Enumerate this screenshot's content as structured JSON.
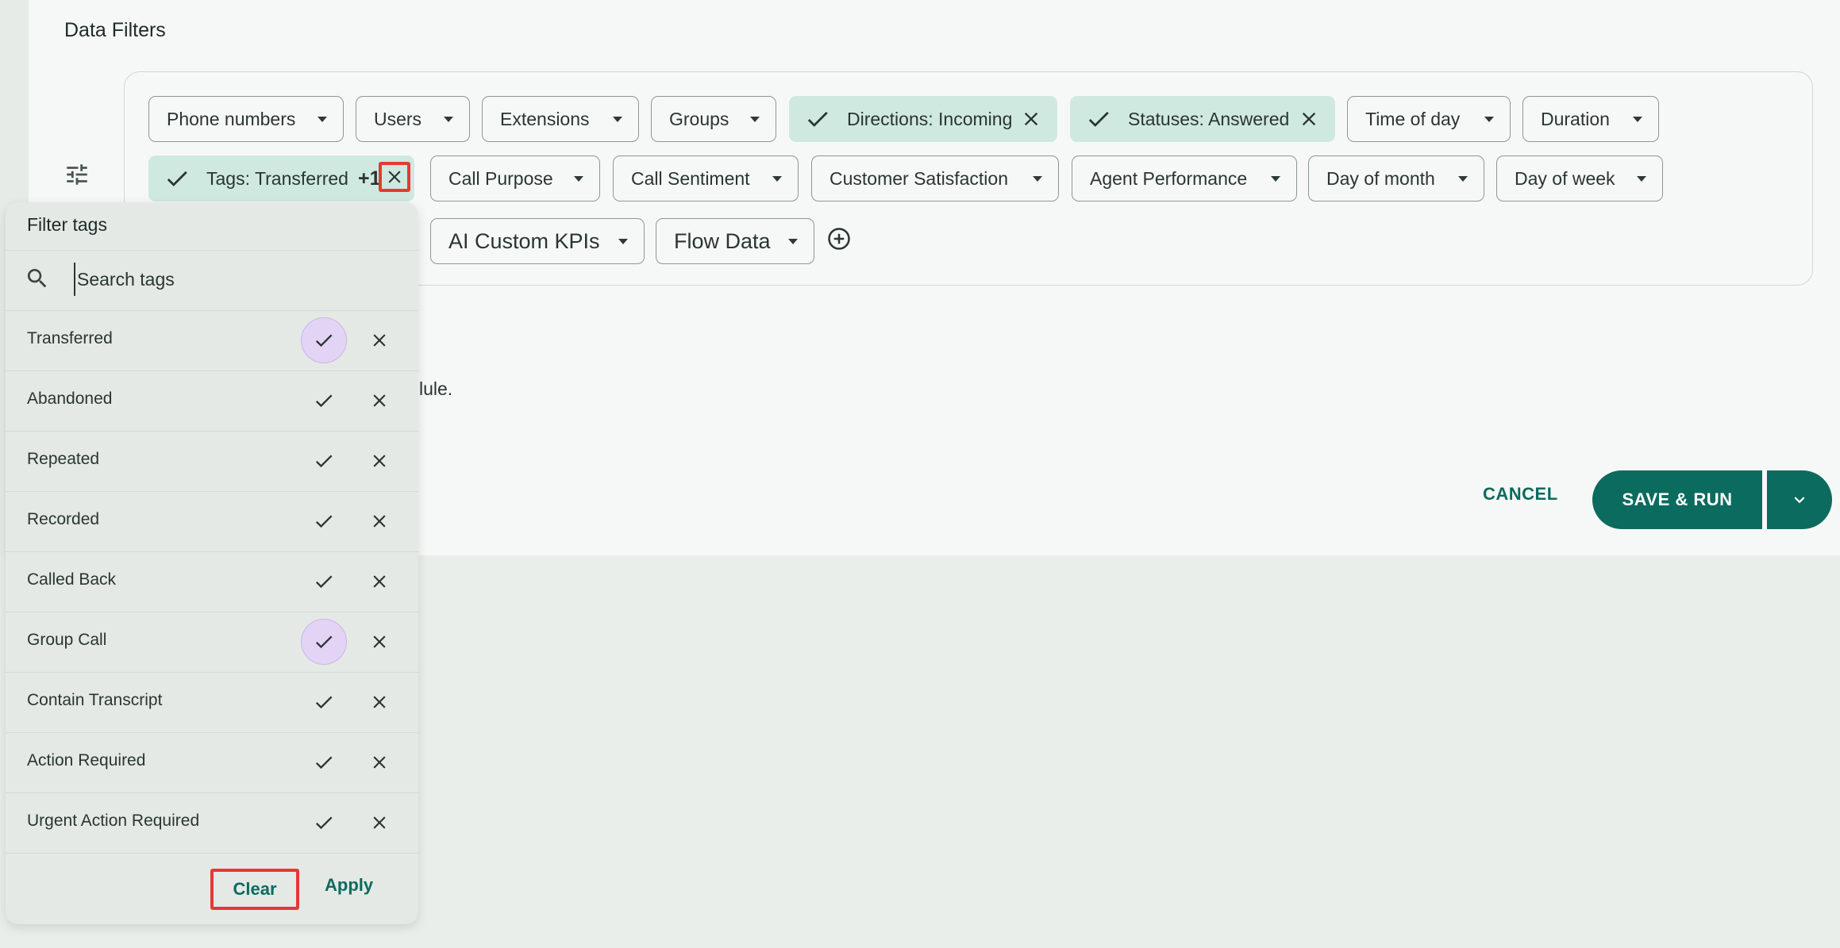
{
  "section_title": "Data Filters",
  "chips": {
    "phone_numbers": "Phone numbers",
    "users": "Users",
    "extensions": "Extensions",
    "groups": "Groups",
    "directions": "Directions: Incoming",
    "statuses": "Statuses: Answered",
    "time_of_day": "Time of day",
    "duration": "Duration",
    "tags": "Tags: Transferred",
    "tags_more": "+1",
    "call_purpose": "Call Purpose",
    "call_sentiment": "Call Sentiment",
    "customer_satisfaction": "Customer Satisfaction",
    "agent_performance": "Agent Performance",
    "day_of_month": "Day of month",
    "day_of_week": "Day of week",
    "ai_custom_kpis": "AI Custom KPIs",
    "flow_data": "Flow Data"
  },
  "background_text": "lule.",
  "actions": {
    "cancel": "CANCEL",
    "save_run": "SAVE & RUN"
  },
  "popup": {
    "title": "Filter tags",
    "search_placeholder": "Search tags",
    "tags": [
      {
        "label": "Transferred",
        "selected": true
      },
      {
        "label": "Abandoned",
        "selected": false
      },
      {
        "label": "Repeated",
        "selected": false
      },
      {
        "label": "Recorded",
        "selected": false
      },
      {
        "label": "Called Back",
        "selected": false
      },
      {
        "label": "Group Call",
        "selected": true
      },
      {
        "label": "Contain Transcript",
        "selected": false
      },
      {
        "label": "Action Required",
        "selected": false
      },
      {
        "label": "Urgent Action Required",
        "selected": false
      }
    ],
    "clear": "Clear",
    "apply": "Apply"
  },
  "colors": {
    "accent": "#0b6b5e",
    "active_chip": "#cfe9e1",
    "selected_check": "#e3d3f4",
    "highlight_box": "#e53935"
  }
}
